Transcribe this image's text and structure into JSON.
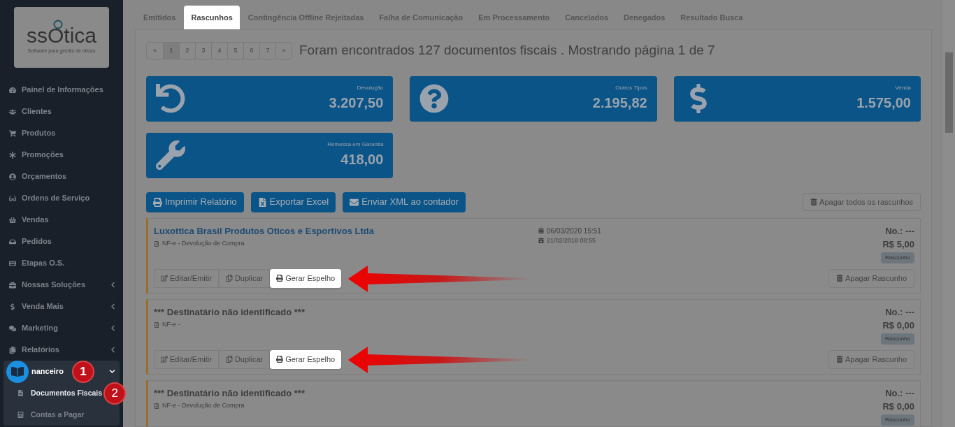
{
  "sidebar": {
    "logo": {
      "wordmark": "ssOtica",
      "tagline": "Software para gestão de óticas"
    },
    "items": [
      {
        "label": "Painel de Informações"
      },
      {
        "label": "Clientes"
      },
      {
        "label": "Produtos"
      },
      {
        "label": "Promoções"
      },
      {
        "label": "Orçamentos"
      },
      {
        "label": "Ordens de Serviço"
      },
      {
        "label": "Vendas"
      },
      {
        "label": "Pedidos"
      },
      {
        "label": "Etapas O.S."
      },
      {
        "label": "Nossas Soluções",
        "expanded": false
      },
      {
        "label": "Venda Mais",
        "expanded": false
      },
      {
        "label": "Marketing",
        "expanded": false
      },
      {
        "label": "Relatórios",
        "expanded": false
      },
      {
        "label": "nanceiro",
        "expanded": true,
        "callout": "1",
        "children": [
          {
            "label": "Documentos Fiscais",
            "selected": true,
            "callout": "2"
          },
          {
            "label": "Contas a Pagar",
            "selected": false
          }
        ]
      }
    ]
  },
  "tabs": [
    {
      "label": "Emitidos",
      "selected": false
    },
    {
      "label": "Rascunhos",
      "selected": true
    },
    {
      "label": "Contingência Offline Rejeitadas",
      "selected": false
    },
    {
      "label": "Falha de Comunicação",
      "selected": false
    },
    {
      "label": "Em Processamento",
      "selected": false
    },
    {
      "label": "Cancelados",
      "selected": false
    },
    {
      "label": "Denegados",
      "selected": false
    },
    {
      "label": "Resultado Busca",
      "selected": false
    }
  ],
  "pagination": {
    "pages": [
      {
        "label": "«",
        "selected": false
      },
      {
        "label": "1",
        "selected": true
      },
      {
        "label": "2",
        "selected": false
      },
      {
        "label": "3",
        "selected": false
      },
      {
        "label": "4",
        "selected": false
      },
      {
        "label": "5",
        "selected": false
      },
      {
        "label": "6",
        "selected": false
      },
      {
        "label": "7",
        "selected": false
      },
      {
        "label": "»",
        "selected": false
      }
    ],
    "summary": "Foram encontrados 127 documentos fiscais . Mostrando página 1 de 7"
  },
  "stats": [
    {
      "kind": "return",
      "label": "Devolução",
      "value": "3.207,50"
    },
    {
      "kind": "other",
      "label": "Outros Tipos",
      "value": "2.195,82"
    },
    {
      "kind": "sale",
      "label": "Venda",
      "value": "1.575,00"
    },
    {
      "kind": "warranty",
      "label": "Remessa em Garantia",
      "value": "418,00"
    }
  ],
  "actions": [
    {
      "kind": "print",
      "label": "Imprimir Relatório"
    },
    {
      "kind": "excel",
      "label": "Exportar Excel"
    },
    {
      "kind": "mail",
      "label": "Enviar XML ao contador"
    }
  ],
  "delete_all": "Apagar todos os rascunhos",
  "documents": [
    {
      "recipient": "Luxottica Brasil Produtos Oticos e Esportivos Ltda",
      "linked": true,
      "type": "NF-e - Devolução de Compra",
      "created": "06/03/2020 15:51",
      "issued": "21/02/2018 08:55",
      "number": "No.: ---",
      "amount": "R$ 5,00",
      "status": "Rascunho",
      "buttons": [
        {
          "kind": "edit",
          "label": "Editar/Emitir",
          "highlighted": false
        },
        {
          "kind": "copy",
          "label": "Duplicar",
          "highlighted": false
        },
        {
          "kind": "print",
          "label": "Gerar Espelho",
          "highlighted": true
        }
      ],
      "delete": "Apagar Rascunho"
    },
    {
      "recipient": "*** Destinatário não identificado ***",
      "linked": false,
      "type": "NF-e -",
      "number": "No.: ---",
      "amount": "R$ 0,00",
      "status": "Rascunho",
      "buttons": [
        {
          "kind": "edit",
          "label": "Editar/Emitir",
          "highlighted": false
        },
        {
          "kind": "copy",
          "label": "Duplicar",
          "highlighted": false
        },
        {
          "kind": "print",
          "label": "Gerar Espelho",
          "highlighted": true
        }
      ],
      "delete": "Apagar Rascunho"
    },
    {
      "recipient": "*** Destinatário não identificado ***",
      "linked": false,
      "type": "NF-e - Devolução de Compra",
      "number": "No.: ---",
      "amount": "R$ 0,00",
      "status": "Rascunho"
    }
  ]
}
